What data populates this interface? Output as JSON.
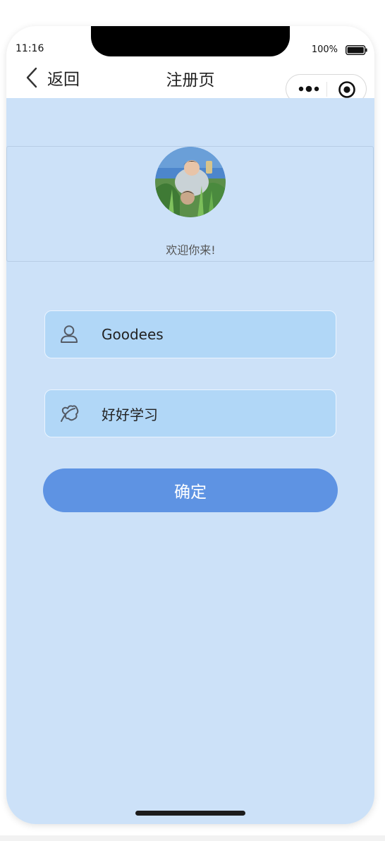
{
  "status_bar": {
    "time": "11:16",
    "battery": "100%"
  },
  "nav": {
    "back_label": "返回",
    "title": "注册页"
  },
  "capsule": {
    "more_icon": "more-dots-icon",
    "close_icon": "target-circle-icon"
  },
  "welcome": {
    "text": "欢迎你来!",
    "avatar_icon": "user-avatar-photo"
  },
  "form": {
    "username": {
      "value": "Goodees",
      "icon": "user-icon"
    },
    "password": {
      "value": "好好学习",
      "icon": "leaf-icon"
    },
    "confirm_label": "确定"
  },
  "colors": {
    "background": "#cce1f8",
    "field": "#b1d7f7",
    "button": "#5e93e3"
  }
}
